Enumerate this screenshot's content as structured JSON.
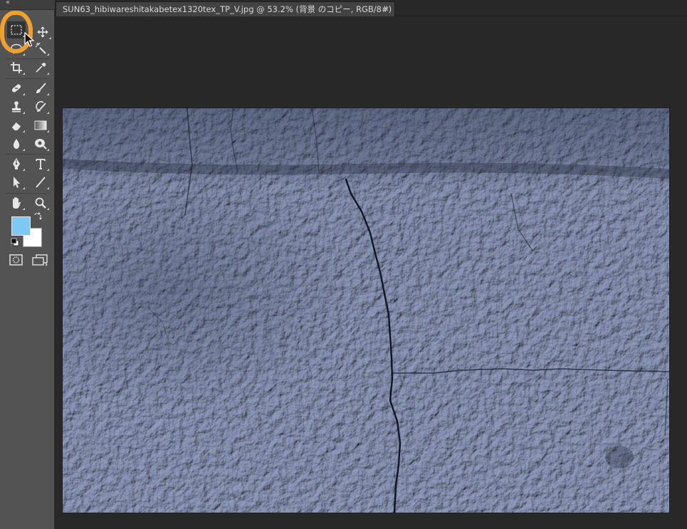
{
  "document_tab": {
    "title": "SUN63_hibiwareshitakabetex1320tex_TP_V.jpg @ 53.2% (背景 のコピー, RGB/8#) *",
    "close_glyph": "×"
  },
  "toolbar": {
    "collapse_glyph": "‹‹",
    "tools": [
      {
        "name": "rectangular-marquee-tool",
        "icon": "marquee-icon",
        "selected": true
      },
      {
        "name": "move-tool",
        "icon": "move-icon"
      },
      {
        "name": "lasso-tool",
        "icon": "lasso-icon"
      },
      {
        "name": "magic-wand-tool",
        "icon": "magic-wand-icon"
      },
      {
        "name": "crop-tool",
        "icon": "crop-icon"
      },
      {
        "name": "eyedropper-tool",
        "icon": "eyedropper-icon"
      },
      {
        "name": "spot-healing-brush-tool",
        "icon": "healing-brush-icon"
      },
      {
        "name": "brush-tool",
        "icon": "brush-icon"
      },
      {
        "name": "clone-stamp-tool",
        "icon": "stamp-icon"
      },
      {
        "name": "history-brush-tool",
        "icon": "history-brush-icon"
      },
      {
        "name": "eraser-tool",
        "icon": "eraser-icon"
      },
      {
        "name": "gradient-tool",
        "icon": "gradient-icon"
      },
      {
        "name": "blur-tool",
        "icon": "blur-drop-icon"
      },
      {
        "name": "dodge-tool",
        "icon": "dodge-icon"
      },
      {
        "name": "pen-tool",
        "icon": "pen-icon"
      },
      {
        "name": "type-tool",
        "icon": "type-icon",
        "label": "T"
      },
      {
        "name": "path-selection-tool",
        "icon": "path-selection-icon"
      },
      {
        "name": "line-tool",
        "icon": "line-icon"
      },
      {
        "name": "hand-tool",
        "icon": "hand-icon"
      },
      {
        "name": "zoom-tool",
        "icon": "zoom-icon"
      }
    ],
    "foreground_color": "#7ec8f5",
    "background_color": "#ffffff",
    "highlight_color": "#f0a030"
  }
}
